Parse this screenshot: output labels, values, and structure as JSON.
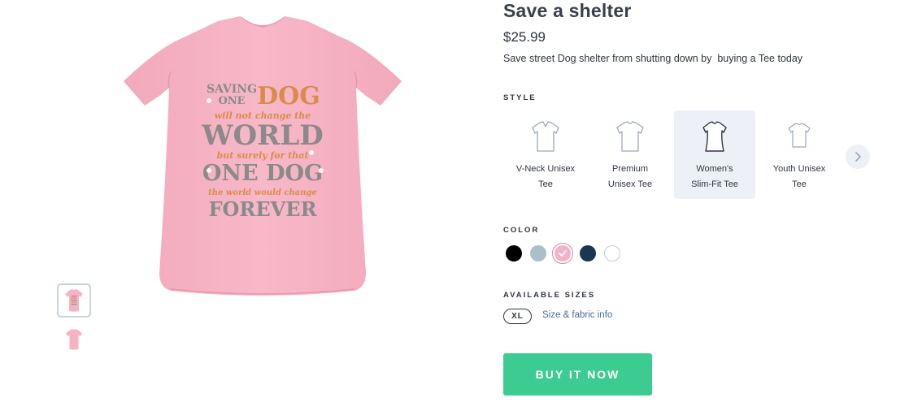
{
  "product": {
    "title": "Save a shelter",
    "price": "$25.99",
    "description": "Save street Dog shelter from shutting down by  buying a Tee today"
  },
  "design_print": {
    "lines": [
      "SAVING",
      "ONE",
      "DOG",
      "will not change the",
      "WORLD",
      "but surely for that",
      "ONE DOG",
      "the world would change",
      "FOREVER"
    ]
  },
  "style": {
    "label": "STYLE",
    "options": [
      {
        "name_line1": "V-Neck Unisex",
        "name_line2": "Tee",
        "icon": "v-neck-tee-icon"
      },
      {
        "name_line1": "Premium",
        "name_line2": "Unisex Tee",
        "icon": "premium-tee-icon"
      },
      {
        "name_line1": "Women's",
        "name_line2": "Slim-Fit Tee",
        "icon": "womens-tee-icon"
      },
      {
        "name_line1": "Youth Unisex",
        "name_line2": "Tee",
        "icon": "youth-tee-icon"
      }
    ],
    "selected_index": 2,
    "next_icon": "chevron-right-icon"
  },
  "color": {
    "label": "COLOR",
    "swatches": [
      "#000000",
      "#a9bfca",
      "#f0b3c8",
      "#1c3553",
      "#ffffff"
    ],
    "selected_index": 2
  },
  "sizes": {
    "label": "AVAILABLE SIZES",
    "options": [
      "XL"
    ],
    "guide_link": "Size & fabric info"
  },
  "buy": {
    "label": "BUY IT NOW"
  },
  "colors": {
    "shirt_pink": "#f6b3c4",
    "accent_green": "#3ccc91",
    "link_blue": "#4a6aa3",
    "text_dark": "#303643",
    "print_gray": "#7b7b7b",
    "print_orange": "#d98c4a"
  }
}
